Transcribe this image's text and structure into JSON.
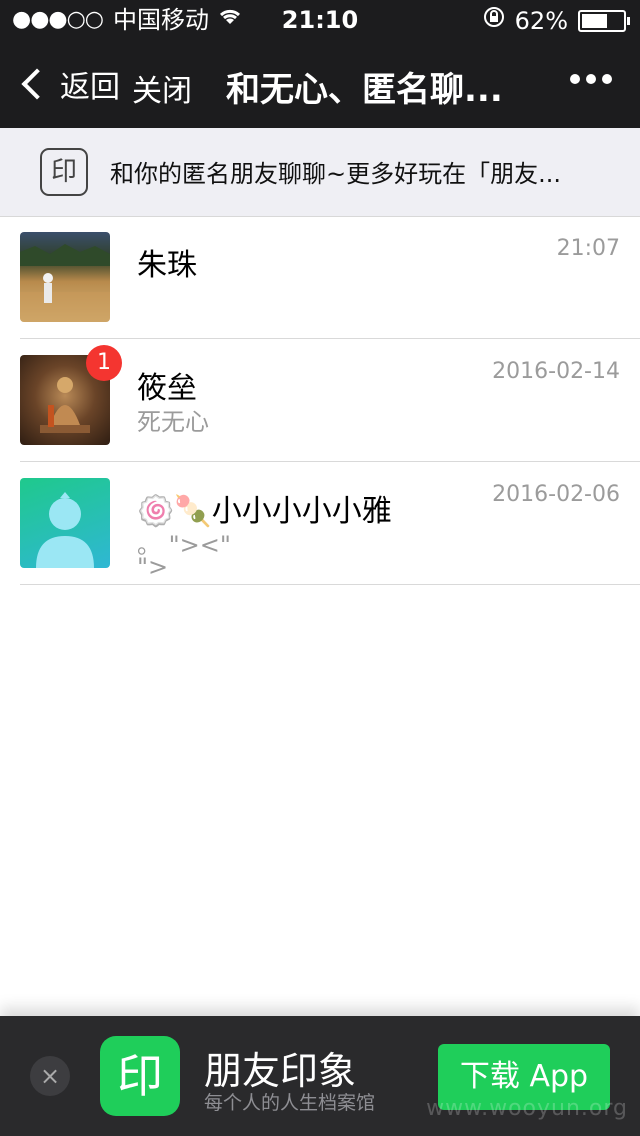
{
  "status_bar": {
    "signal": "●●●○○",
    "carrier": "中国移动",
    "time": "21:10",
    "battery": "62%",
    "battery_level": 0.62
  },
  "nav": {
    "back_label": "返回",
    "close_label": "关闭",
    "title": "和无心、匿名聊..."
  },
  "banner": {
    "icon_text": "印",
    "text": "和你的匿名朋友聊聊~更多好玩在「朋友..."
  },
  "chats": [
    {
      "name": "朱珠",
      "time": "21:07",
      "preview": ""
    },
    {
      "name": "筱垒",
      "time": "2016-02-14",
      "preview": "死无心",
      "badge": "1"
    },
    {
      "name": "🍥🍡小小小小小雅",
      "time": "2016-02-06",
      "preview": "。 \"><\"\n\">"
    }
  ],
  "footer": {
    "close_icon": "×",
    "app_icon_text": "印",
    "app_name": "朋友印象",
    "tagline": "每个人的人生档案馆",
    "download_label": "下载 App",
    "watermark": "www.wooyun.org"
  }
}
